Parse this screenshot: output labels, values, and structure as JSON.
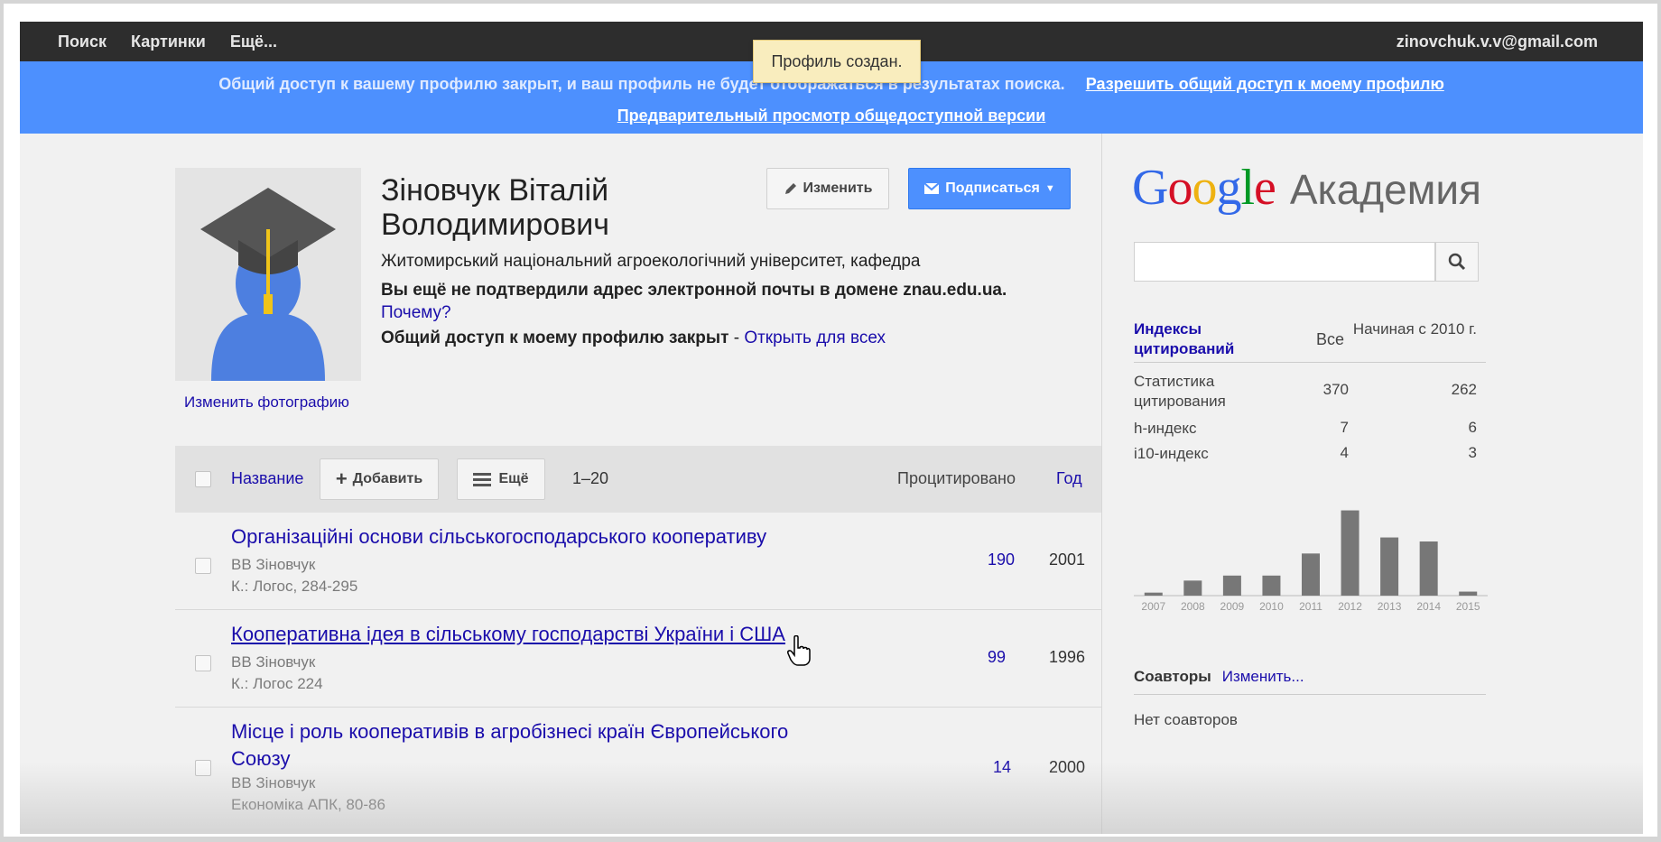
{
  "topbar": {
    "nav": [
      "Поиск",
      "Картинки",
      "Ещё..."
    ],
    "email": "zinovchuk.v.v@gmail.com"
  },
  "toast": "Профиль создан.",
  "banner": {
    "text": "Общий доступ к вашему профилю закрыт, и ваш профиль не будет отображаться в результатах поиска.",
    "allow_link": "Разрешить общий доступ к моему профилю",
    "preview_link": "Предварительный просмотр общедоступной версии"
  },
  "profile": {
    "name": "Зіновчук Віталій Володимирович",
    "affiliation": "Житомирський національний агроекологічний університет, кафедра",
    "verify_text": "Вы ещё не подтвердили адрес электронной почты в домене znau.edu.ua.",
    "why_link": "Почему?",
    "access_text": "Общий доступ к моему профилю закрыт",
    "access_sep": " - ",
    "open_link": "Открыть для всех",
    "change_photo": "Изменить фотографию",
    "edit_button": "Изменить",
    "subscribe_button": "Подписаться"
  },
  "table": {
    "title_col": "Название",
    "add_button": "Добавить",
    "more_button": "Ещё",
    "range": "1–20",
    "cited_col": "Процитировано",
    "year_col": "Год",
    "rows": [
      {
        "title": "Організаційні основи сільськогосподарського кооперативу",
        "authors": "ВВ Зіновчук",
        "source": "К.: Логос, 284-295",
        "cites": "190",
        "year": "2001"
      },
      {
        "title": "Кооперативна ідея в сільському господарстві України і США",
        "authors": "ВВ Зіновчук",
        "source": "К.: Логос 224",
        "cites": "99",
        "year": "1996"
      },
      {
        "title": "Місце і роль кооперативів в агробізнесі країн Європейського Союзу",
        "authors": "ВВ Зіновчук",
        "source": "Економіка АПК, 80-86",
        "cites": "14",
        "year": "2000"
      }
    ]
  },
  "right": {
    "logo_google": "Google",
    "logo_academy": "Академия",
    "citation_title": "Индексы цитирований",
    "col_all": "Все",
    "col_since": "Начиная с 2010 г.",
    "stats": [
      {
        "label": "Статистика цитирования",
        "all": "370",
        "since": "262"
      },
      {
        "label": "h-индекс",
        "all": "7",
        "since": "6"
      },
      {
        "label": "i10-индекс",
        "all": "4",
        "since": "3"
      }
    ],
    "coauthors_label": "Соавторы",
    "coauthors_edit": "Изменить...",
    "no_coauthors": "Нет соавторов"
  },
  "chart_data": {
    "type": "bar",
    "categories": [
      "2007",
      "2008",
      "2009",
      "2010",
      "2011",
      "2012",
      "2013",
      "2014",
      "2015"
    ],
    "values": [
      3,
      15,
      20,
      20,
      42,
      85,
      58,
      54,
      4
    ],
    "ylim": [
      0,
      90
    ]
  }
}
